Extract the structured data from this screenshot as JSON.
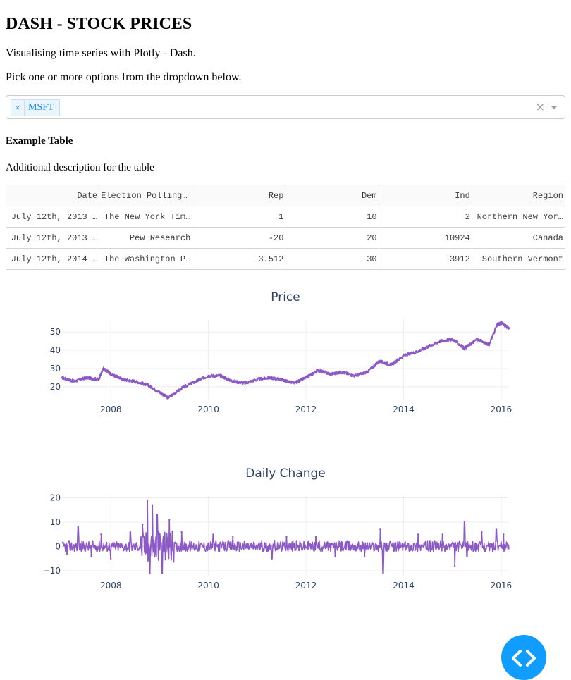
{
  "header": {
    "title": "DASH - STOCK PRICES",
    "subtitle": "Visualising time series with Plotly - Dash.",
    "instructions": "Pick one or more options from the dropdown below."
  },
  "dropdown": {
    "selected": [
      "MSFT"
    ],
    "remove_glyph": "×",
    "clear_glyph": "×",
    "icons": [
      "remove-chip-icon",
      "clear-icon",
      "chevron-down-icon"
    ]
  },
  "table": {
    "title": "Example Table",
    "description": "Additional description for the table",
    "columns": [
      "Date",
      "Election Polling O",
      "Rep",
      "Dem",
      "Ind",
      "Region"
    ],
    "rows": [
      [
        "July 12th, 2013 …",
        "The New York Tim…",
        "1",
        "10",
        "2",
        "Northern New Yor…"
      ],
      [
        "July 12th, 2013 …",
        "Pew Research",
        "-20",
        "20",
        "10924",
        "Canada"
      ],
      [
        "July 12th, 2014 …",
        "The Washington P…",
        "3.512",
        "30",
        "3912",
        "Southern Vermont"
      ]
    ]
  },
  "chart_data": [
    {
      "type": "line",
      "title": "Price",
      "line_color": "#8c59c7",
      "x_ticks": [
        "2008",
        "2010",
        "2012",
        "2014",
        "2016"
      ],
      "y_ticks": [
        "20",
        "30",
        "40",
        "50"
      ],
      "xlim": [
        2007.0,
        2016.16
      ],
      "ylim": [
        13,
        57
      ],
      "grid": true,
      "x": [
        2007.0,
        2007.25,
        2007.5,
        2007.75,
        2007.85,
        2008.0,
        2008.25,
        2008.5,
        2008.75,
        2009.0,
        2009.17,
        2009.5,
        2009.75,
        2010.0,
        2010.25,
        2010.5,
        2010.75,
        2011.0,
        2011.25,
        2011.5,
        2011.75,
        2012.0,
        2012.25,
        2012.5,
        2012.75,
        2013.0,
        2013.25,
        2013.5,
        2013.75,
        2014.0,
        2014.25,
        2014.5,
        2014.75,
        2015.0,
        2015.25,
        2015.5,
        2015.75,
        2015.92,
        2016.0,
        2016.16
      ],
      "y": [
        25,
        23,
        25,
        24,
        30,
        27,
        24,
        23,
        21,
        17,
        14,
        20,
        23,
        26,
        26,
        23,
        22,
        24,
        25,
        24,
        22,
        25,
        29,
        27,
        28,
        26,
        28,
        34,
        32,
        37,
        39,
        42,
        45,
        46,
        41,
        46,
        43,
        54,
        55,
        52
      ]
    },
    {
      "type": "line",
      "title": "Daily Change",
      "line_color": "#8c59c7",
      "x_ticks": [
        "2008",
        "2010",
        "2012",
        "2014",
        "2016"
      ],
      "y_ticks": [
        "20",
        "10",
        "0",
        "−10"
      ],
      "xlim": [
        2007.0,
        2016.16
      ],
      "ylim": [
        -12,
        21
      ],
      "grid": true,
      "x": [
        2007.1,
        2007.33,
        2007.6,
        2007.8,
        2008.0,
        2008.4,
        2008.65,
        2008.75,
        2008.8,
        2008.85,
        2008.95,
        2009.05,
        2009.2,
        2009.45,
        2010.1,
        2010.5,
        2011.3,
        2011.6,
        2012.2,
        2012.6,
        2013.2,
        2013.52,
        2013.58,
        2014.3,
        2014.8,
        2015.05,
        2015.25,
        2015.3,
        2015.6,
        2015.9,
        2016.05
      ],
      "y": [
        -3,
        8,
        -4,
        5,
        -5,
        6,
        9,
        19,
        -11,
        17,
        13,
        -11,
        11,
        6,
        5,
        4,
        -5,
        4,
        4,
        -4,
        -4,
        7,
        -11,
        5,
        5,
        -8,
        10,
        -4,
        6,
        7,
        5
      ]
    }
  ],
  "fab": {
    "icon": "code-brackets-icon"
  }
}
